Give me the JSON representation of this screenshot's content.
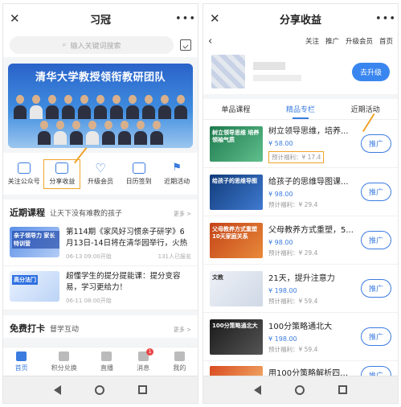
{
  "left": {
    "title": "习冠",
    "search_placeholder": "输入关键词搜索",
    "banner_title": "清华大学教授领衔教研团队",
    "quick": [
      "关注公众号",
      "分享收益",
      "升级会员",
      "日历签到",
      "近期活动"
    ],
    "recent": {
      "heading": "近期课程",
      "sub": "让天下没有难教的孩子",
      "more": "更多 >",
      "items": [
        {
          "thumb": "亲子领导力\n家长特训营",
          "title": "第114期《家风好习惯亲子研学》6月13日-14日将在清华园举行，火热报...",
          "date": "06-13 09:00开始",
          "count": "131人已报名"
        },
        {
          "thumb": "高分法门",
          "title": "超懂学生的提分提能课：提分变容易，学习更给力！",
          "date": "06-11 08:00开始",
          "count": ""
        }
      ]
    },
    "daka": {
      "heading": "免费打卡",
      "sub": "督学互动",
      "more": "更多 >"
    },
    "tabs": [
      "首页",
      "积分兑换",
      "直播",
      "消息",
      "我的"
    ],
    "badge": "1"
  },
  "right": {
    "title": "分享收益",
    "subnav": [
      "关注",
      "推广",
      "升级会员",
      "首页"
    ],
    "upgrade": "去升级",
    "tabs": [
      "单品课程",
      "精品专栏",
      "近期活动"
    ],
    "items": [
      {
        "thumb": "树立领导思维\n培养领袖气质",
        "title": "树立领导思维，培养...",
        "price": "¥ 58.00",
        "earn": "预计福利：¥ 17.4",
        "btn": "推广"
      },
      {
        "thumb": "给孩子的思维导图",
        "title": "给孩子的思维导图课...",
        "price": "¥ 98.00",
        "earn": "预计福利：¥ 29.4",
        "btn": "推广"
      },
      {
        "thumb": "父母教养方式重塑\n10天家庭关系",
        "title": "父母教养方式重塑，5...",
        "price": "¥ 98.00",
        "earn": "预计福利：¥ 29.4",
        "btn": "推广"
      },
      {
        "thumb": "文教",
        "title": "21天，提升注意力",
        "price": "¥ 198.00",
        "earn": "预计福利：¥ 59.4",
        "btn": "推广"
      },
      {
        "thumb": "100分策略通北大",
        "title": "100分策略通北大",
        "price": "¥ 198.00",
        "earn": "预计福利：¥ 59.4",
        "btn": "推广"
      },
      {
        "thumb": "",
        "title": "用100分策略解析四年...",
        "price": "",
        "earn": "",
        "btn": "推广"
      }
    ]
  },
  "colors": {
    "accent": "#3a7be0",
    "highlight": "#f0a32a"
  }
}
